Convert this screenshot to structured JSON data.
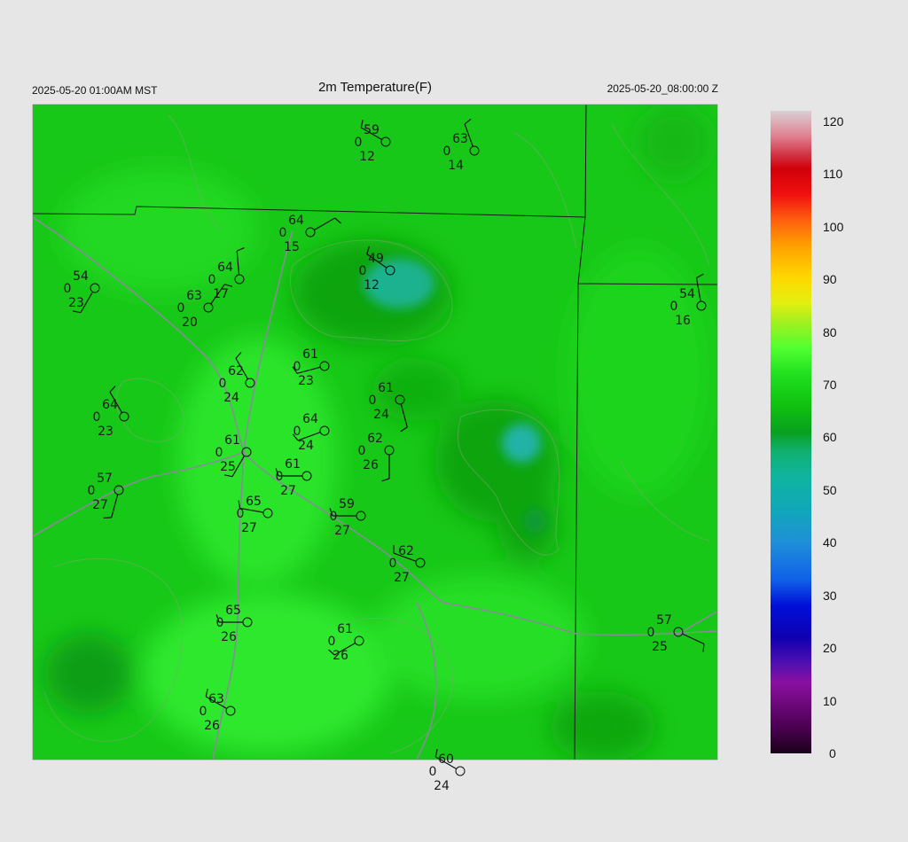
{
  "header": {
    "left_time": "2025-05-20 01:00AM MST",
    "title": "2m Temperature(F)",
    "right_time": "2025-05-20_08:00:00 Z"
  },
  "colors": {
    "background": "#e6e6e6",
    "field_green": "#18c818",
    "bright_green": "#2ee82e",
    "dark_green": "#0aa80a",
    "cool_teal": "#1fb58f",
    "border": "#1a1a1a",
    "road": "#8a8a9a"
  },
  "colorbar": {
    "labels": [
      "120",
      "110",
      "100",
      "90",
      "80",
      "70",
      "60",
      "50",
      "40",
      "30",
      "20",
      "10",
      "0"
    ],
    "min": 0,
    "max": 122
  },
  "stations": [
    {
      "t": "59",
      "w": "0",
      "d": "12",
      "dir": 300
    },
    {
      "t": "63",
      "w": "0",
      "d": "14",
      "dir": 340
    },
    {
      "t": "64",
      "w": "0",
      "d": "15",
      "dir": 60
    },
    {
      "t": "49",
      "w": "0",
      "d": "12",
      "dir": 305
    },
    {
      "t": "64",
      "w": "0",
      "d": "17",
      "dir": 355
    },
    {
      "t": "63",
      "w": "0",
      "d": "20",
      "dir": 35
    },
    {
      "t": "54",
      "w": "0",
      "d": "23",
      "dir": 210
    },
    {
      "t": "54",
      "w": "0",
      "d": "16",
      "dir": 350
    },
    {
      "t": "62",
      "w": "0",
      "d": "24",
      "dir": 330
    },
    {
      "t": "61",
      "w": "0",
      "d": "23",
      "dir": 255
    },
    {
      "t": "61",
      "w": "0",
      "d": "24",
      "dir": 165
    },
    {
      "t": "64",
      "w": "0",
      "d": "23",
      "dir": 330
    },
    {
      "t": "61",
      "w": "0",
      "d": "25",
      "dir": 210
    },
    {
      "t": "64",
      "w": "0",
      "d": "24",
      "dir": 250
    },
    {
      "t": "62",
      "w": "0",
      "d": "26",
      "dir": 180
    },
    {
      "t": "61",
      "w": "0",
      "d": "27",
      "dir": 270
    },
    {
      "t": "57",
      "w": "0",
      "d": "27",
      "dir": 195
    },
    {
      "t": "65",
      "w": "0",
      "d": "27",
      "dir": 280
    },
    {
      "t": "59",
      "w": "0",
      "d": "27",
      "dir": 270
    },
    {
      "t": "62",
      "w": "0",
      "d": "27",
      "dir": 290
    },
    {
      "t": "65",
      "w": "0",
      "d": "26",
      "dir": 270
    },
    {
      "t": "61",
      "w": "0",
      "d": "26",
      "dir": 240
    },
    {
      "t": "57",
      "w": "0",
      "d": "25",
      "dir": 115
    },
    {
      "t": "63",
      "w": "0",
      "d": "26",
      "dir": 300
    },
    {
      "t": "60",
      "w": "0",
      "d": "24",
      "dir": 300
    }
  ]
}
